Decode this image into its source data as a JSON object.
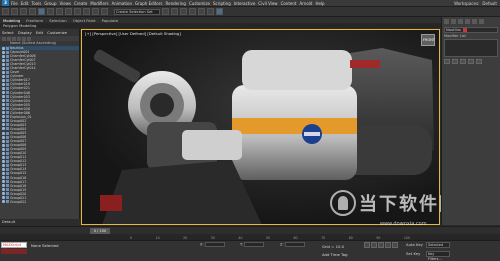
{
  "app": {
    "logo_text": "3"
  },
  "menu": [
    "File",
    "Edit",
    "Tools",
    "Group",
    "Views",
    "Create",
    "Modifiers",
    "Animation",
    "Graph Editors",
    "Rendering",
    "Customize",
    "Scripting",
    "Interactive",
    "Civil View",
    "Content",
    "Arnold",
    "Help"
  ],
  "title_right": {
    "workspaces_label": "Workspaces:",
    "workspace_value": "Default"
  },
  "ribbon": {
    "selection_set_placeholder": "Create Selection Set"
  },
  "tabs": [
    "Modeling",
    "Freeform",
    "Selection",
    "Object Paint",
    "Populate"
  ],
  "sub_ribbon_label": "Polygon Modeling",
  "scene_explorer": {
    "toolbar": [
      "Select",
      "Display",
      "Edit",
      "Customize"
    ],
    "column_header": "Name (Sorted Ascending)",
    "items": [
      "Nautilus",
      "Capsule004",
      "ChamferCyl006",
      "ChamferCyl007",
      "ChamferCyl013",
      "ChamferCyl014",
      "Cover",
      "Cylinder",
      "Cylinder017",
      "Cylinder019",
      "Cylinder021",
      "Cylinder046",
      "Cylinder053",
      "Cylinder054",
      "Cylinder055",
      "Cylinder058",
      "Cylinder086",
      "Explosion_01",
      "Group002",
      "Group003",
      "Group004",
      "Group005",
      "Group006",
      "Group007",
      "Group008",
      "Group009",
      "Group010",
      "Group011",
      "Group012",
      "Group013",
      "Group014",
      "Group015",
      "Group016",
      "Group017",
      "Group018",
      "Group019",
      "Group020",
      "Group021",
      "Group022"
    ],
    "footer_label": "Default"
  },
  "viewport": {
    "label": "[+] [Perspective] [User Defined] [Default Shading]",
    "viewcube_face": "FRONT"
  },
  "command_panel": {
    "modifier_list_label": "Modifier List",
    "object_name": "Nautilus"
  },
  "timeline": {
    "slider": "0 / 100",
    "ticks": [
      "0",
      "10",
      "20",
      "30",
      "40",
      "50",
      "60",
      "70",
      "80",
      "90",
      "100"
    ]
  },
  "status": {
    "maxscript_label": "MAXScript Mi",
    "message": "None Selected",
    "x_label": "X:",
    "y_label": "Y:",
    "z_label": "Z:",
    "grid": "Grid = 10.0",
    "add_time_tag": "Add Time Tag",
    "auto_key": "Auto Key",
    "key_selection": "Selected",
    "set_key": "Set Key",
    "key_filters": "Key Filters..."
  },
  "watermark": {
    "text": "当下软件园",
    "url": "www.downxia.com"
  },
  "colors": {
    "nasa_orange": "#e39a2b",
    "accent_blue": "#1c77b4",
    "viewport_border": "#e6b640"
  }
}
